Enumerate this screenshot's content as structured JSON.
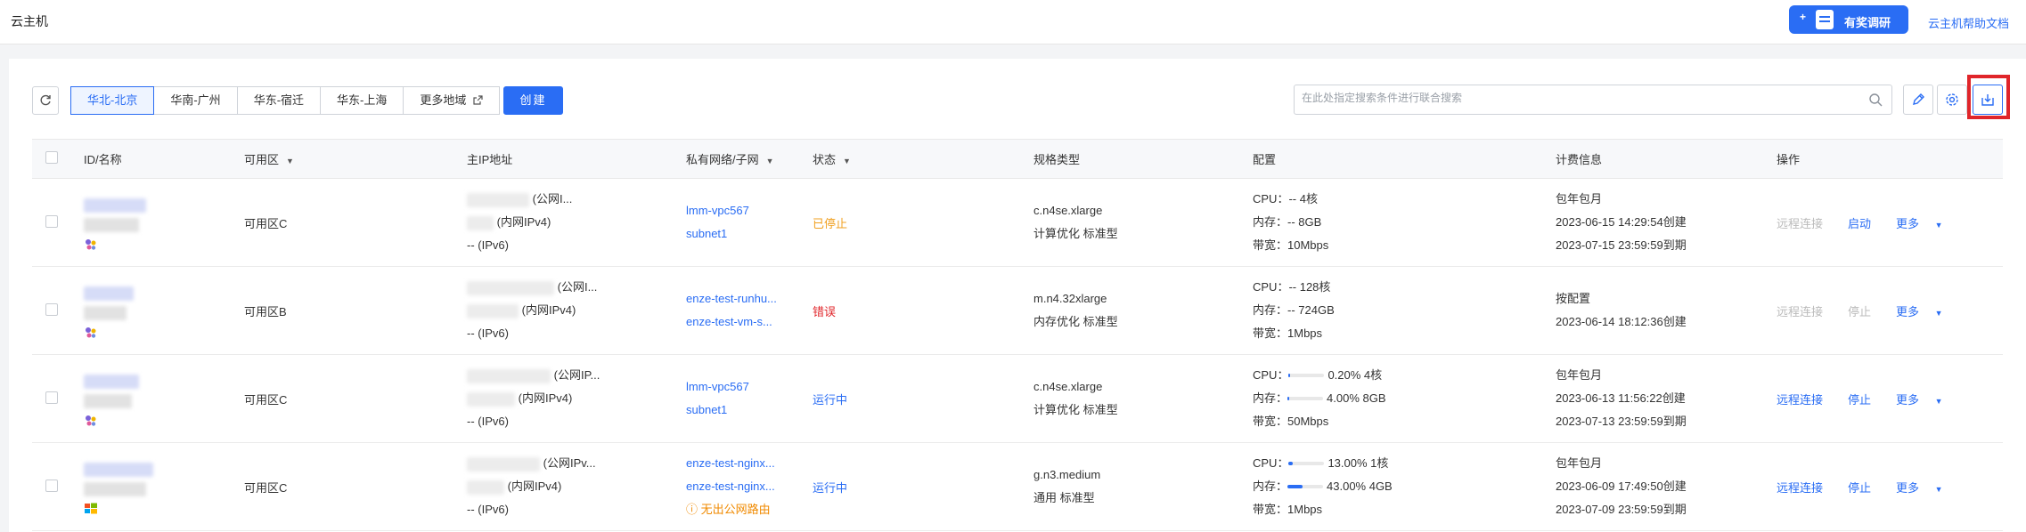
{
  "header": {
    "title": "云主机",
    "survey_label": "有奖调研",
    "help_link": "云主机帮助文档"
  },
  "toolbar": {
    "regions": [
      {
        "label": "华北-北京",
        "active": true
      },
      {
        "label": "华南-广州",
        "active": false
      },
      {
        "label": "华东-宿迁",
        "active": false
      },
      {
        "label": "华东-上海",
        "active": false
      },
      {
        "label": "更多地域",
        "active": false
      }
    ],
    "create_label": "创建",
    "search_placeholder": "在此处指定搜索条件进行联合搜索"
  },
  "table": {
    "headers": {
      "id": "ID/名称",
      "az": "可用区",
      "ip": "主IP地址",
      "vpc": "私有网络/子网",
      "status": "状态",
      "spec": "规格类型",
      "config": "配置",
      "billing": "计费信息",
      "ops": "操作"
    },
    "rows": [
      {
        "az": "可用区C",
        "ip": {
          "public": "(公网I...",
          "private": "(内网IPv4)",
          "v6": "-- (IPv6)"
        },
        "vpc": "lmm-vpc567",
        "subnet": "subnet1",
        "warn": "",
        "status": "已停止",
        "status_color": "orange",
        "spec": "c.n4se.xlarge",
        "spec_family": "计算优化 标准型",
        "cpu": "-- 4核",
        "mem": "-- 8GB",
        "bw": "10Mbps",
        "cpu_pct": null,
        "mem_pct": null,
        "billing": [
          "包年包月",
          "2023-06-15 14:29:54创建",
          "2023-07-15 23:59:59到期"
        ],
        "ops": [
          {
            "label": "远程连接",
            "enabled": false
          },
          {
            "label": "启动",
            "enabled": true
          },
          {
            "label": "更多",
            "enabled": true
          }
        ],
        "os_icon": "cluster-icon"
      },
      {
        "az": "可用区B",
        "ip": {
          "public": "(公网I...",
          "private": "(内网IPv4)",
          "v6": "-- (IPv6)"
        },
        "vpc": "enze-test-runhu...",
        "subnet": "enze-test-vm-s...",
        "warn": "",
        "status": "错误",
        "status_color": "red",
        "spec": "m.n4.32xlarge",
        "spec_family": "内存优化 标准型",
        "cpu": "-- 128核",
        "mem": "-- 724GB",
        "bw": "1Mbps",
        "cpu_pct": null,
        "mem_pct": null,
        "billing": [
          "按配置",
          "2023-06-14 18:12:36创建",
          ""
        ],
        "ops": [
          {
            "label": "远程连接",
            "enabled": false
          },
          {
            "label": "停止",
            "enabled": false
          },
          {
            "label": "更多",
            "enabled": true
          }
        ],
        "os_icon": "cluster-icon"
      },
      {
        "az": "可用区C",
        "ip": {
          "public": "(公网IP...",
          "private": "(内网IPv4)",
          "v6": "-- (IPv6)"
        },
        "vpc": "lmm-vpc567",
        "subnet": "subnet1",
        "warn": "",
        "status": "运行中",
        "status_color": "blue",
        "spec": "c.n4se.xlarge",
        "spec_family": "计算优化 标准型",
        "cpu": "0.20% 4核",
        "mem": "4.00% 8GB",
        "bw": "50Mbps",
        "cpu_pct": 0.002,
        "mem_pct": 0.04,
        "billing": [
          "包年包月",
          "2023-06-13 11:56:22创建",
          "2023-07-13 23:59:59到期"
        ],
        "ops": [
          {
            "label": "远程连接",
            "enabled": true
          },
          {
            "label": "停止",
            "enabled": true
          },
          {
            "label": "更多",
            "enabled": true
          }
        ],
        "os_icon": "cluster-icon"
      },
      {
        "az": "可用区C",
        "ip": {
          "public": "(公网IPv...",
          "private": "(内网IPv4)",
          "v6": "-- (IPv6)"
        },
        "vpc": "enze-test-nginx...",
        "subnet": "enze-test-nginx...",
        "warn": "无出公网路由",
        "status": "运行中",
        "status_color": "blue",
        "spec": "g.n3.medium",
        "spec_family": "通用 标准型",
        "cpu": "13.00% 1核",
        "mem": "43.00% 4GB",
        "bw": "1Mbps",
        "cpu_pct": 0.13,
        "mem_pct": 0.43,
        "billing": [
          "包年包月",
          "2023-06-09 17:49:50创建",
          "2023-07-09 23:59:59到期"
        ],
        "ops": [
          {
            "label": "远程连接",
            "enabled": true
          },
          {
            "label": "停止",
            "enabled": true
          },
          {
            "label": "更多",
            "enabled": true
          }
        ],
        "os_icon": "windows-icon"
      }
    ],
    "labels": {
      "cpu": "CPU：",
      "mem": "内存：",
      "bw": "带宽："
    }
  }
}
